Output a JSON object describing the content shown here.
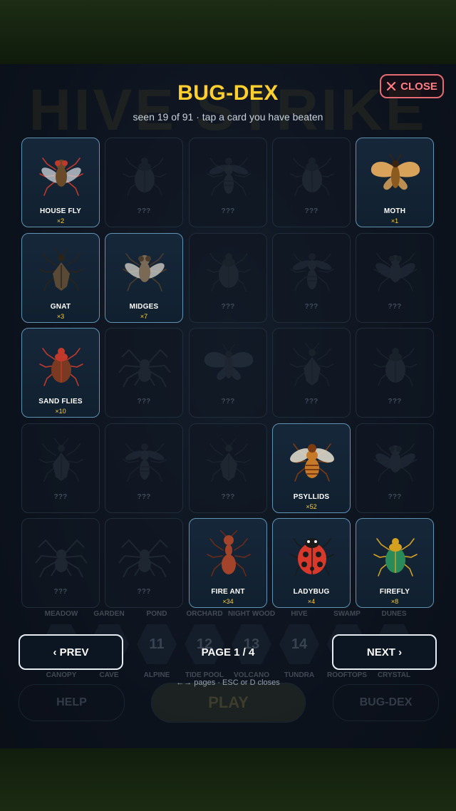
{
  "header": {
    "title": "BUG-DEX",
    "subtitle": "seen 19 of 91   ·   tap a card you have beaten",
    "close_label": "CLOSE"
  },
  "background": {
    "ghost_title": "HIVE STRIKE",
    "zones_row1": [
      "MEADOW",
      "GARDEN",
      "POND",
      "ORCHARD",
      "NIGHT WOOD",
      "HIVE",
      "SWAMP",
      "DUNES"
    ],
    "zones_row2": [
      "CANOPY",
      "CAVE",
      "ALPINE",
      "TIDE POOL",
      "VOLCANO",
      "TUNDRA",
      "ROOFTOPS",
      "CRYSTAL"
    ],
    "hex_numbers": [
      "11",
      "12",
      "13",
      "14"
    ],
    "help_label": "HELP",
    "play_label": "PLAY",
    "bugdex_label": "BUG-DEX"
  },
  "cards": [
    {
      "name": "HOUSE FLY",
      "count": "×2",
      "seen": true,
      "shape": "fly",
      "body": "#6b4a2a",
      "accent": "#c0392b",
      "wing": "#cfd6dc"
    },
    {
      "name": "???",
      "seen": false,
      "shape": "beetle"
    },
    {
      "name": "???",
      "seen": false,
      "shape": "wasp"
    },
    {
      "name": "???",
      "seen": false,
      "shape": "beetle"
    },
    {
      "name": "MOTH",
      "count": "×1",
      "seen": true,
      "shape": "moth",
      "body": "#8a5a1e",
      "accent": "#3a2410",
      "wing": "#d9a25a"
    },
    {
      "name": "GNAT",
      "count": "×3",
      "seen": true,
      "shape": "bug",
      "body": "#5a4a35",
      "accent": "#2a231a",
      "wing": "#8a7a60"
    },
    {
      "name": "MIDGES",
      "count": "×7",
      "seen": true,
      "shape": "fly",
      "body": "#7a6a55",
      "accent": "#4a3c2c",
      "wing": "#d8d6cc"
    },
    {
      "name": "???",
      "seen": false,
      "shape": "beetle"
    },
    {
      "name": "???",
      "seen": false,
      "shape": "wasp"
    },
    {
      "name": "???",
      "seen": false,
      "shape": "fly"
    },
    {
      "name": "SAND FLIES",
      "count": "×10",
      "seen": true,
      "shape": "beetle",
      "body": "#7a3a22",
      "accent": "#c0392b",
      "wing": "#8a4a2a"
    },
    {
      "name": "???",
      "seen": false,
      "shape": "spider"
    },
    {
      "name": "???",
      "seen": false,
      "shape": "moth"
    },
    {
      "name": "???",
      "seen": false,
      "shape": "bug"
    },
    {
      "name": "???",
      "seen": false,
      "shape": "beetle"
    },
    {
      "name": "???",
      "seen": false,
      "shape": "bug"
    },
    {
      "name": "???",
      "seen": false,
      "shape": "wasp"
    },
    {
      "name": "???",
      "seen": false,
      "shape": "bug"
    },
    {
      "name": "PSYLLIDS",
      "count": "×52",
      "seen": true,
      "shape": "bee",
      "body": "#c57a2a",
      "accent": "#7a3a12",
      "wing": "#e8e2d2"
    },
    {
      "name": "???",
      "seen": false,
      "shape": "fly"
    },
    {
      "name": "???",
      "seen": false,
      "shape": "spider"
    },
    {
      "name": "???",
      "seen": false,
      "shape": "spider"
    },
    {
      "name": "FIRE ANT",
      "count": "×34",
      "seen": true,
      "shape": "ant",
      "body": "#a3442a",
      "accent": "#6a2a18",
      "wing": "#a3442a"
    },
    {
      "name": "LADYBUG",
      "count": "×4",
      "seen": true,
      "shape": "ladybug",
      "body": "#d9392a",
      "accent": "#1a1a1a",
      "wing": "#d9392a"
    },
    {
      "name": "FIREFLY",
      "count": "×8",
      "seen": true,
      "shape": "beetle",
      "body": "#2a8a5a",
      "accent": "#d4a020",
      "wing": "#1a5a4a"
    }
  ],
  "pagination": {
    "prev_label": "‹  PREV",
    "next_label": "NEXT  ›",
    "page_label": "PAGE 1 / 4"
  },
  "hint": "←→ pages   ·   ESC or D closes",
  "colors": {
    "accent_gold": "#ffcf2e",
    "close_red": "#ff7d84",
    "card_border_seen": "#5f93b3",
    "overlay_bg": "#0c121c"
  }
}
